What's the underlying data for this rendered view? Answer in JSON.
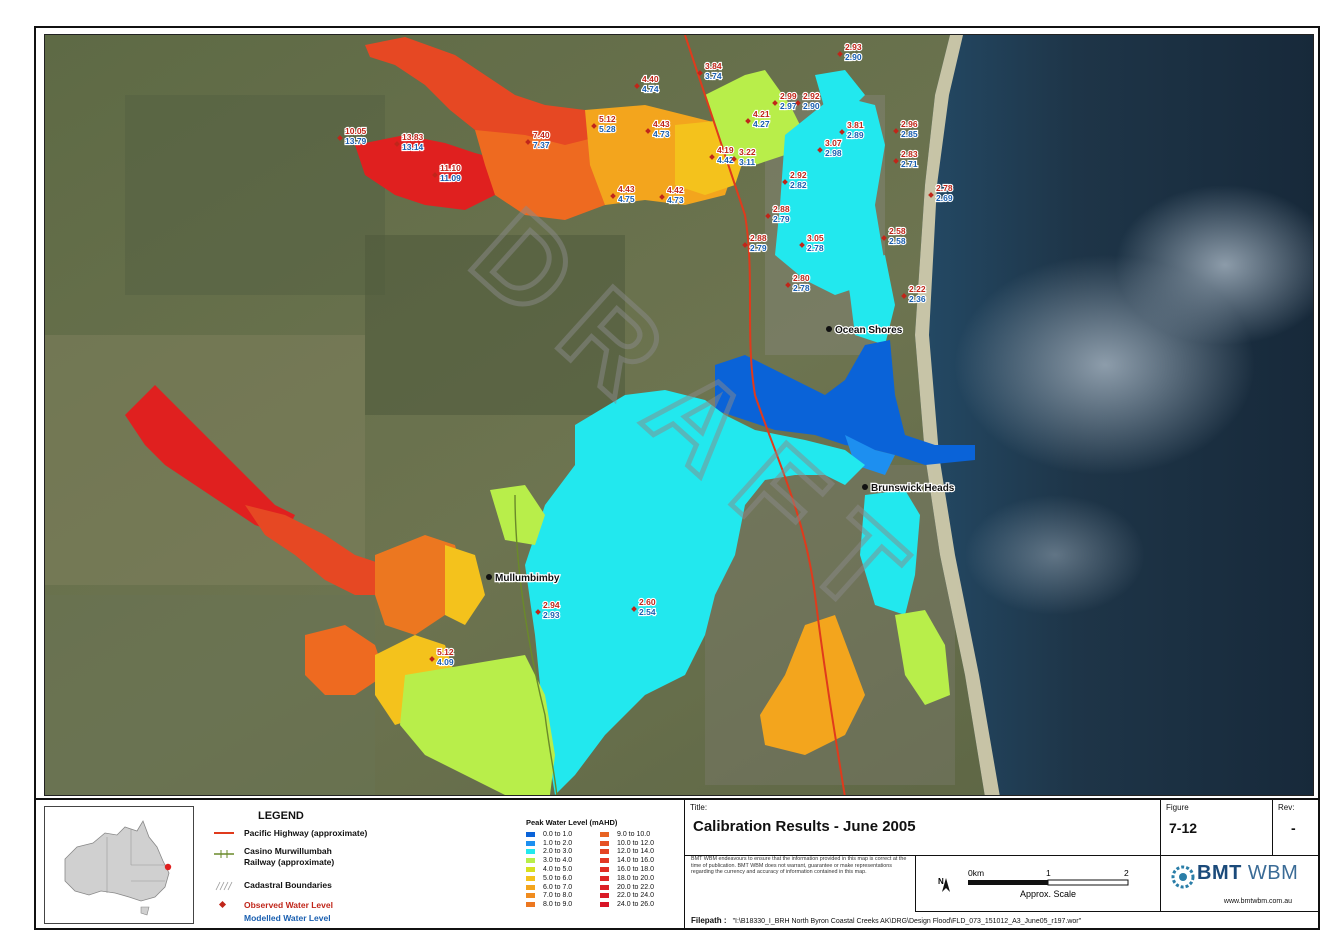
{
  "map": {
    "town_labels": {
      "ocean_shores": "Ocean Shores",
      "brunswick_heads": "Brunswick Heads",
      "mullumbimby": "Mullumbimby"
    },
    "watermark": "DRAFT",
    "levels": [
      {
        "observed": "2.93",
        "modelled": "2.90"
      },
      {
        "observed": "3.84",
        "modelled": "3.74"
      },
      {
        "observed": "4.40",
        "modelled": "4.74"
      },
      {
        "observed": "2.99",
        "modelled": "2.97"
      },
      {
        "observed": "2.92",
        "modelled": "2.90"
      },
      {
        "observed": "4.21",
        "modelled": "4.27"
      },
      {
        "observed": "5.12",
        "modelled": "5.28"
      },
      {
        "observed": "4.43",
        "modelled": "4.73"
      },
      {
        "observed": "7.40",
        "modelled": "7.37"
      },
      {
        "observed": "10.05",
        "modelled": "13.79"
      },
      {
        "observed": "13.83",
        "modelled": "13.14"
      },
      {
        "observed": "11.10",
        "modelled": "11.09"
      },
      {
        "observed": "4.43",
        "modelled": "4.75"
      },
      {
        "observed": "4.42",
        "modelled": "4.73"
      },
      {
        "observed": "4.19",
        "modelled": "4.42"
      },
      {
        "observed": "3.22",
        "modelled": "3.11"
      },
      {
        "observed": "3.81",
        "modelled": "2.89"
      },
      {
        "observed": "3.07",
        "modelled": "2.98"
      },
      {
        "observed": "2.92",
        "modelled": "2.82"
      },
      {
        "observed": "2.96",
        "modelled": "2.85"
      },
      {
        "observed": "2.83",
        "modelled": "2.71"
      },
      {
        "observed": "2.78",
        "modelled": "2.69"
      },
      {
        "observed": "2.88",
        "modelled": "2.79"
      },
      {
        "observed": "2.88",
        "modelled": "2.79"
      },
      {
        "observed": "3.05",
        "modelled": "2.78"
      },
      {
        "observed": "2.58",
        "modelled": "2.58"
      },
      {
        "observed": "2.80",
        "modelled": "2.78"
      },
      {
        "observed": "2.22",
        "modelled": "2.36"
      },
      {
        "observed": "2.94",
        "modelled": "2.93"
      },
      {
        "observed": "2.60",
        "modelled": "2.54"
      },
      {
        "observed": "5.12",
        "modelled": "4.09"
      }
    ]
  },
  "legend": {
    "title": "LEGEND",
    "pacific_highway": "Pacific Highway (approximate)",
    "railway_line1": "Casino Murwillumbah",
    "railway_line2": "Railway (approximate)",
    "cadastral": "Cadastral Boundaries",
    "observed": "Observed Water Level",
    "modelled": "Modelled Water Level"
  },
  "scale_legend": {
    "title": "Peak Water Level (mAHD)",
    "classes": [
      {
        "label": "0.0 to 1.0",
        "color": "#0a63d8"
      },
      {
        "label": "1.0 to 2.0",
        "color": "#1d8ff0"
      },
      {
        "label": "2.0 to 3.0",
        "color": "#22e8ee"
      },
      {
        "label": "3.0 to 4.0",
        "color": "#b8ee4a"
      },
      {
        "label": "4.0 to 5.0",
        "color": "#d7e020"
      },
      {
        "label": "5.0 to 6.0",
        "color": "#f4c21c"
      },
      {
        "label": "6.0 to 7.0",
        "color": "#f3a51d"
      },
      {
        "label": "7.0 to 8.0",
        "color": "#f08c1f"
      },
      {
        "label": "8.0 to 9.0",
        "color": "#ec7720"
      },
      {
        "label": "9.0 to 10.0",
        "color": "#e86322"
      },
      {
        "label": "10.0 to 12.0",
        "color": "#e65123"
      },
      {
        "label": "12.0 to 14.0",
        "color": "#e44424"
      },
      {
        "label": "14.0 to 16.0",
        "color": "#e23825"
      },
      {
        "label": "16.0 to 18.0",
        "color": "#e02e25"
      },
      {
        "label": "18.0 to 20.0",
        "color": "#de2626"
      },
      {
        "label": "20.0 to 22.0",
        "color": "#dc2026"
      },
      {
        "label": "22.0 to 24.0",
        "color": "#da1a26"
      },
      {
        "label": "24.0 to 26.0",
        "color": "#d81426"
      }
    ]
  },
  "titleblock": {
    "title_label": "Title:",
    "title": "Calibration Results - June 2005",
    "figure_label": "Figure",
    "figure": "7-12",
    "rev_label": "Rev:",
    "rev": "-",
    "disclaimer": "BMT WBM endeavours to ensure that the information provided in this map is correct at the time of publication. BMT WBM does not warrant, guarantee or make representations regarding the currency and accuracy of information contained in this map.",
    "scale_zero": "0km",
    "scale_one": "1",
    "scale_two": "2",
    "scale_caption": "Approx. Scale",
    "north": "N",
    "brand": "BMT",
    "brand2": "WBM",
    "website": "www.bmtwbm.com.au",
    "filepath_label": "Filepath :",
    "filepath": "\"I:\\B18330_I_BRH North Byron Coastal Creeks AK\\DRG\\Design Flood\\FLD_073_151012_A3_June05_r197.wor\""
  }
}
